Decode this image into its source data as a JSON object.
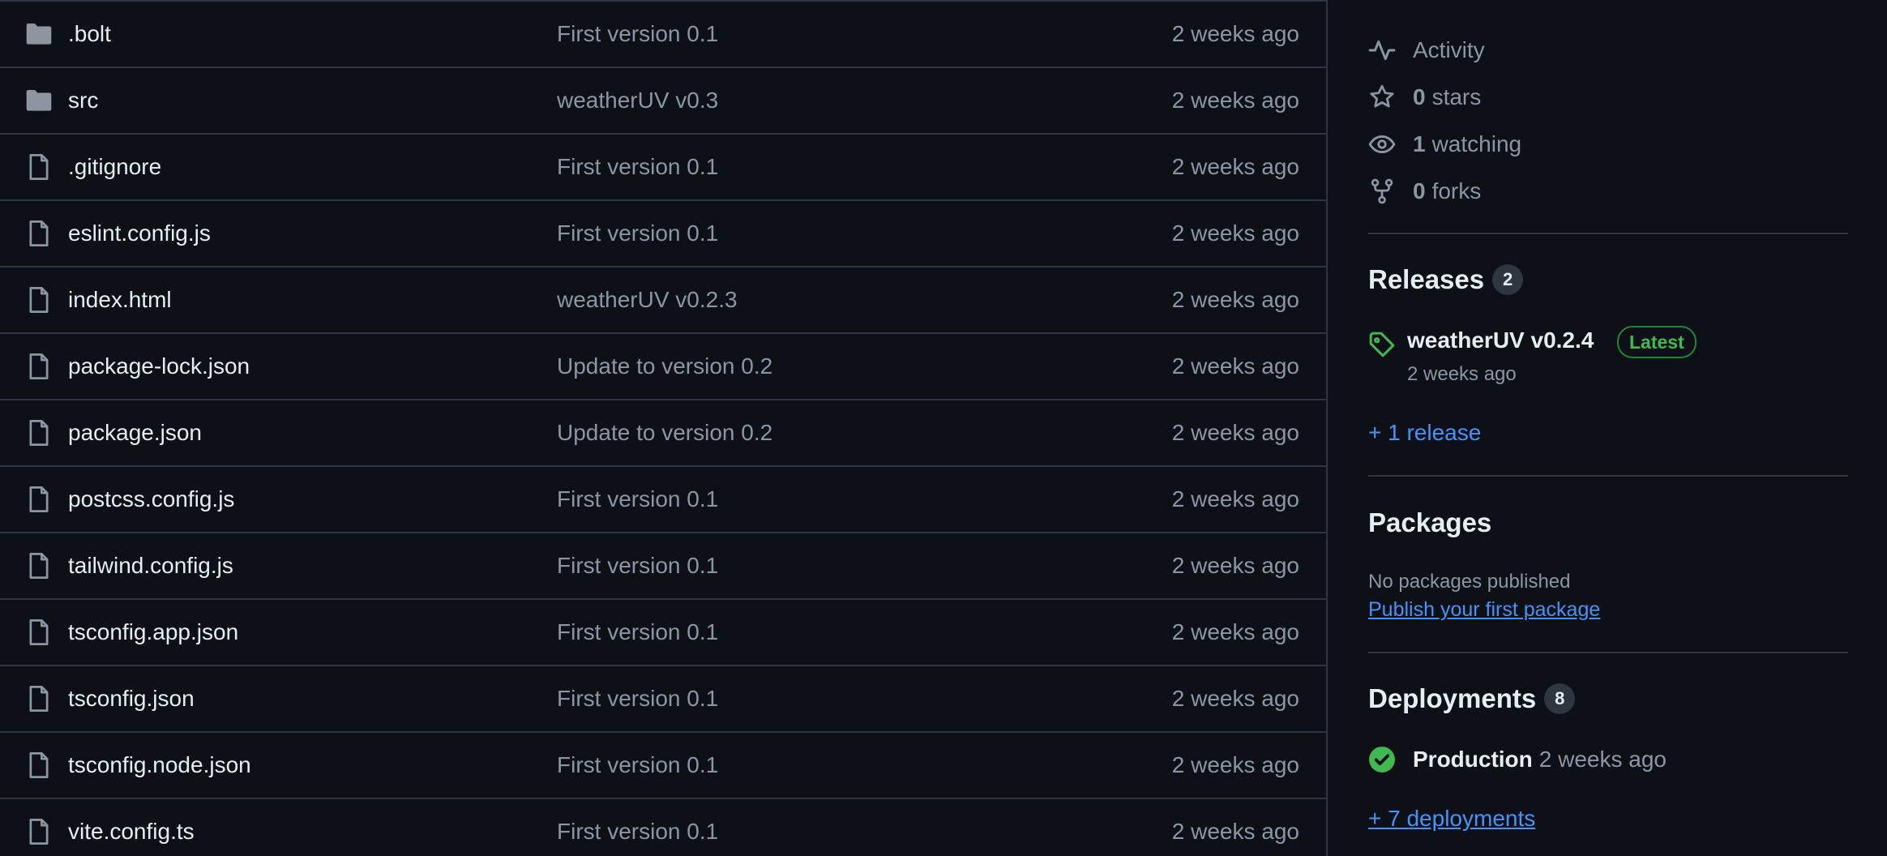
{
  "files": [
    {
      "type": "folder",
      "name": ".bolt",
      "commit": "First version 0.1",
      "time": "2 weeks ago"
    },
    {
      "type": "folder",
      "name": "src",
      "commit": "weatherUV v0.3",
      "time": "2 weeks ago"
    },
    {
      "type": "file",
      "name": ".gitignore",
      "commit": "First version 0.1",
      "time": "2 weeks ago"
    },
    {
      "type": "file",
      "name": "eslint.config.js",
      "commit": "First version 0.1",
      "time": "2 weeks ago"
    },
    {
      "type": "file",
      "name": "index.html",
      "commit": "weatherUV v0.2.3",
      "time": "2 weeks ago"
    },
    {
      "type": "file",
      "name": "package-lock.json",
      "commit": "Update to version 0.2",
      "time": "2 weeks ago"
    },
    {
      "type": "file",
      "name": "package.json",
      "commit": "Update to version 0.2",
      "time": "2 weeks ago"
    },
    {
      "type": "file",
      "name": "postcss.config.js",
      "commit": "First version 0.1",
      "time": "2 weeks ago"
    },
    {
      "type": "file",
      "name": "tailwind.config.js",
      "commit": "First version 0.1",
      "time": "2 weeks ago"
    },
    {
      "type": "file",
      "name": "tsconfig.app.json",
      "commit": "First version 0.1",
      "time": "2 weeks ago"
    },
    {
      "type": "file",
      "name": "tsconfig.json",
      "commit": "First version 0.1",
      "time": "2 weeks ago"
    },
    {
      "type": "file",
      "name": "tsconfig.node.json",
      "commit": "First version 0.1",
      "time": "2 weeks ago"
    },
    {
      "type": "file",
      "name": "vite.config.ts",
      "commit": "First version 0.1",
      "time": "2 weeks ago"
    }
  ],
  "sidebar": {
    "activity": {
      "label": "Activity",
      "icon": "pulse-icon"
    },
    "stars": {
      "count": "0",
      "label": "stars",
      "icon": "star-icon"
    },
    "watching": {
      "count": "1",
      "label": "watching",
      "icon": "eye-icon"
    },
    "forks": {
      "count": "0",
      "label": "forks",
      "icon": "fork-icon"
    },
    "releases": {
      "title": "Releases",
      "count": "2",
      "latest_name": "weatherUV v0.2.4",
      "latest_badge": "Latest",
      "latest_date": "2 weeks ago",
      "more_link": "+ 1 release"
    },
    "packages": {
      "title": "Packages",
      "empty_text": "No packages published",
      "publish_link": "Publish your first package"
    },
    "deployments": {
      "title": "Deployments",
      "count": "8",
      "env_name": "Production",
      "env_time": "2 weeks ago",
      "more_link": "+ 7 deployments"
    }
  },
  "colors": {
    "background": "#0d1117",
    "border": "#30363d",
    "text": "#e6edf3",
    "muted": "#8d96a0",
    "link": "#4493f8",
    "success": "#3fb950"
  }
}
